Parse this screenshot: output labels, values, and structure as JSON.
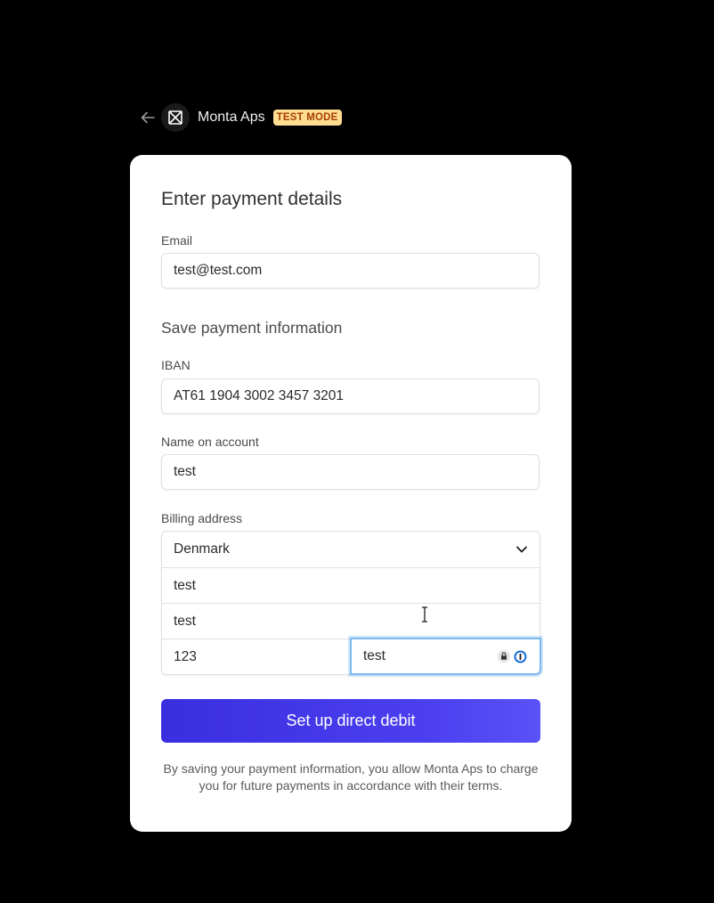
{
  "header": {
    "merchant_name": "Monta Aps",
    "badge": "TEST MODE"
  },
  "form": {
    "title": "Enter payment details",
    "email": {
      "label": "Email",
      "value": "test@test.com"
    },
    "save_section_title": "Save payment information",
    "iban": {
      "label": "IBAN",
      "value": "AT61 1904 3002 3457 3201"
    },
    "name": {
      "label": "Name on account",
      "value": "test"
    },
    "billing": {
      "label": "Billing address",
      "country": "Denmark",
      "line1": "test",
      "line2": "test",
      "postal_code": "123",
      "city": "test"
    },
    "submit_label": "Set up direct debit",
    "legal_text": "By saving your payment information, you allow Monta Aps to charge you for future payments in accordance with their terms."
  },
  "colors": {
    "button_start": "#3a2fe0",
    "button_end": "#5a52f7",
    "badge_bg": "#ffde92",
    "badge_text": "#a63d00",
    "focus_ring": "#7cb8f0"
  },
  "icons": [
    "back-arrow-icon",
    "merchant-logo-icon",
    "chevron-down-icon",
    "lock-icon",
    "password-manager-icon",
    "text-cursor-icon"
  ]
}
